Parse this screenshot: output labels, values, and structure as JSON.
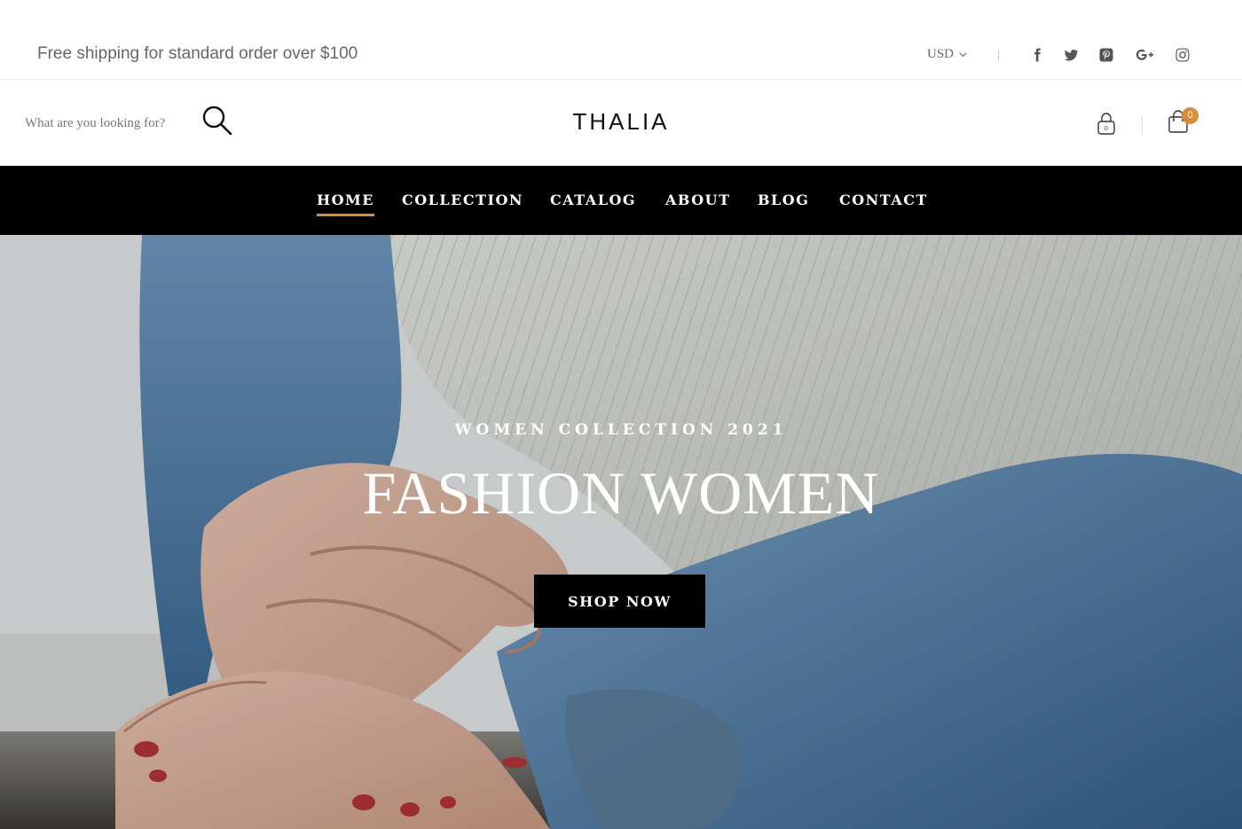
{
  "topbar": {
    "promo": "Free shipping for standard order over $100",
    "currency": "USD",
    "social": [
      "facebook-icon",
      "twitter-icon",
      "pinterest-icon",
      "google-plus-icon",
      "instagram-icon"
    ]
  },
  "header": {
    "search_placeholder": "What are you looking for?",
    "logo": "THALIA",
    "cart_count": "0"
  },
  "nav": {
    "items": [
      {
        "label": "HOME",
        "active": true
      },
      {
        "label": "COLLECTION",
        "active": false
      },
      {
        "label": "CATALOG",
        "active": false
      },
      {
        "label": "ABOUT",
        "active": false
      },
      {
        "label": "BLOG",
        "active": false
      },
      {
        "label": "CONTACT",
        "active": false
      }
    ]
  },
  "hero": {
    "eyebrow": "WOMEN COLLECTION 2021",
    "headline": "FASHION WOMEN",
    "cta": "SHOP NOW"
  },
  "colors": {
    "accent": "#d68d3c",
    "nav_bg": "#000000"
  }
}
